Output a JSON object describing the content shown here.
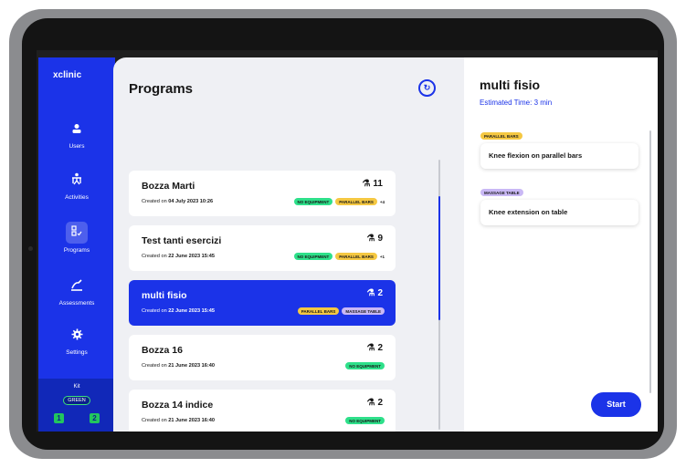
{
  "sidebar": {
    "brand": "xclinic",
    "items": [
      {
        "label": "Users",
        "icon": "person-icon"
      },
      {
        "label": "Activities",
        "icon": "activity-icon"
      },
      {
        "label": "Programs",
        "icon": "programs-icon"
      },
      {
        "label": "Assessments",
        "icon": "assessments-icon"
      },
      {
        "label": "Settings",
        "icon": "gear-icon"
      }
    ],
    "active": "Programs",
    "kit": {
      "label": "Kit",
      "status": "GREEN",
      "slots": [
        "1",
        "2"
      ]
    }
  },
  "programs": {
    "title": "Programs",
    "list": [
      {
        "title": "Bozza Marti",
        "created_prefix": "Created on",
        "created_date": "04 July 2023 10:26",
        "count": "11",
        "tags": [
          "NO EQUIPMENT",
          "PARALLEL BARS"
        ],
        "more": "+4"
      },
      {
        "title": "Test tanti esercizi",
        "created_prefix": "Created on",
        "created_date": "22 June 2023 15:45",
        "count": "9",
        "tags": [
          "NO EQUIPMENT",
          "PARALLEL BARS"
        ],
        "more": "+1"
      },
      {
        "title": "multi fisio",
        "created_prefix": "Created on",
        "created_date": "22 June 2023 15:45",
        "count": "2",
        "tags": [
          "PARALLEL BARS",
          "MASSAGE TABLE"
        ],
        "more": ""
      },
      {
        "title": "Bozza 16",
        "created_prefix": "Created on",
        "created_date": "21 June 2023 16:40",
        "count": "2",
        "tags": [
          "NO EQUIPMENT"
        ],
        "more": ""
      },
      {
        "title": "Bozza 14 indice",
        "created_prefix": "Created on",
        "created_date": "21 June 2023 16:40",
        "count": "2",
        "tags": [
          "NO EQUIPMENT"
        ],
        "more": ""
      }
    ]
  },
  "detail": {
    "title": "multi fisio",
    "estimated_time": "Estimated Time: 3 min",
    "exercises": [
      {
        "tag": "PARALLEL BARS",
        "name": "Knee flexion on parallel bars"
      },
      {
        "tag": "MASSAGE TABLE",
        "name": "Knee extension on table"
      }
    ],
    "start_label": "Start"
  },
  "colors": {
    "accent": "#1b33e8",
    "tag_no_equipment": "#2ee08a",
    "tag_parallel_bars": "#f5c842",
    "tag_massage_table": "#c9b8f5",
    "kit_green": "#22c55e"
  }
}
